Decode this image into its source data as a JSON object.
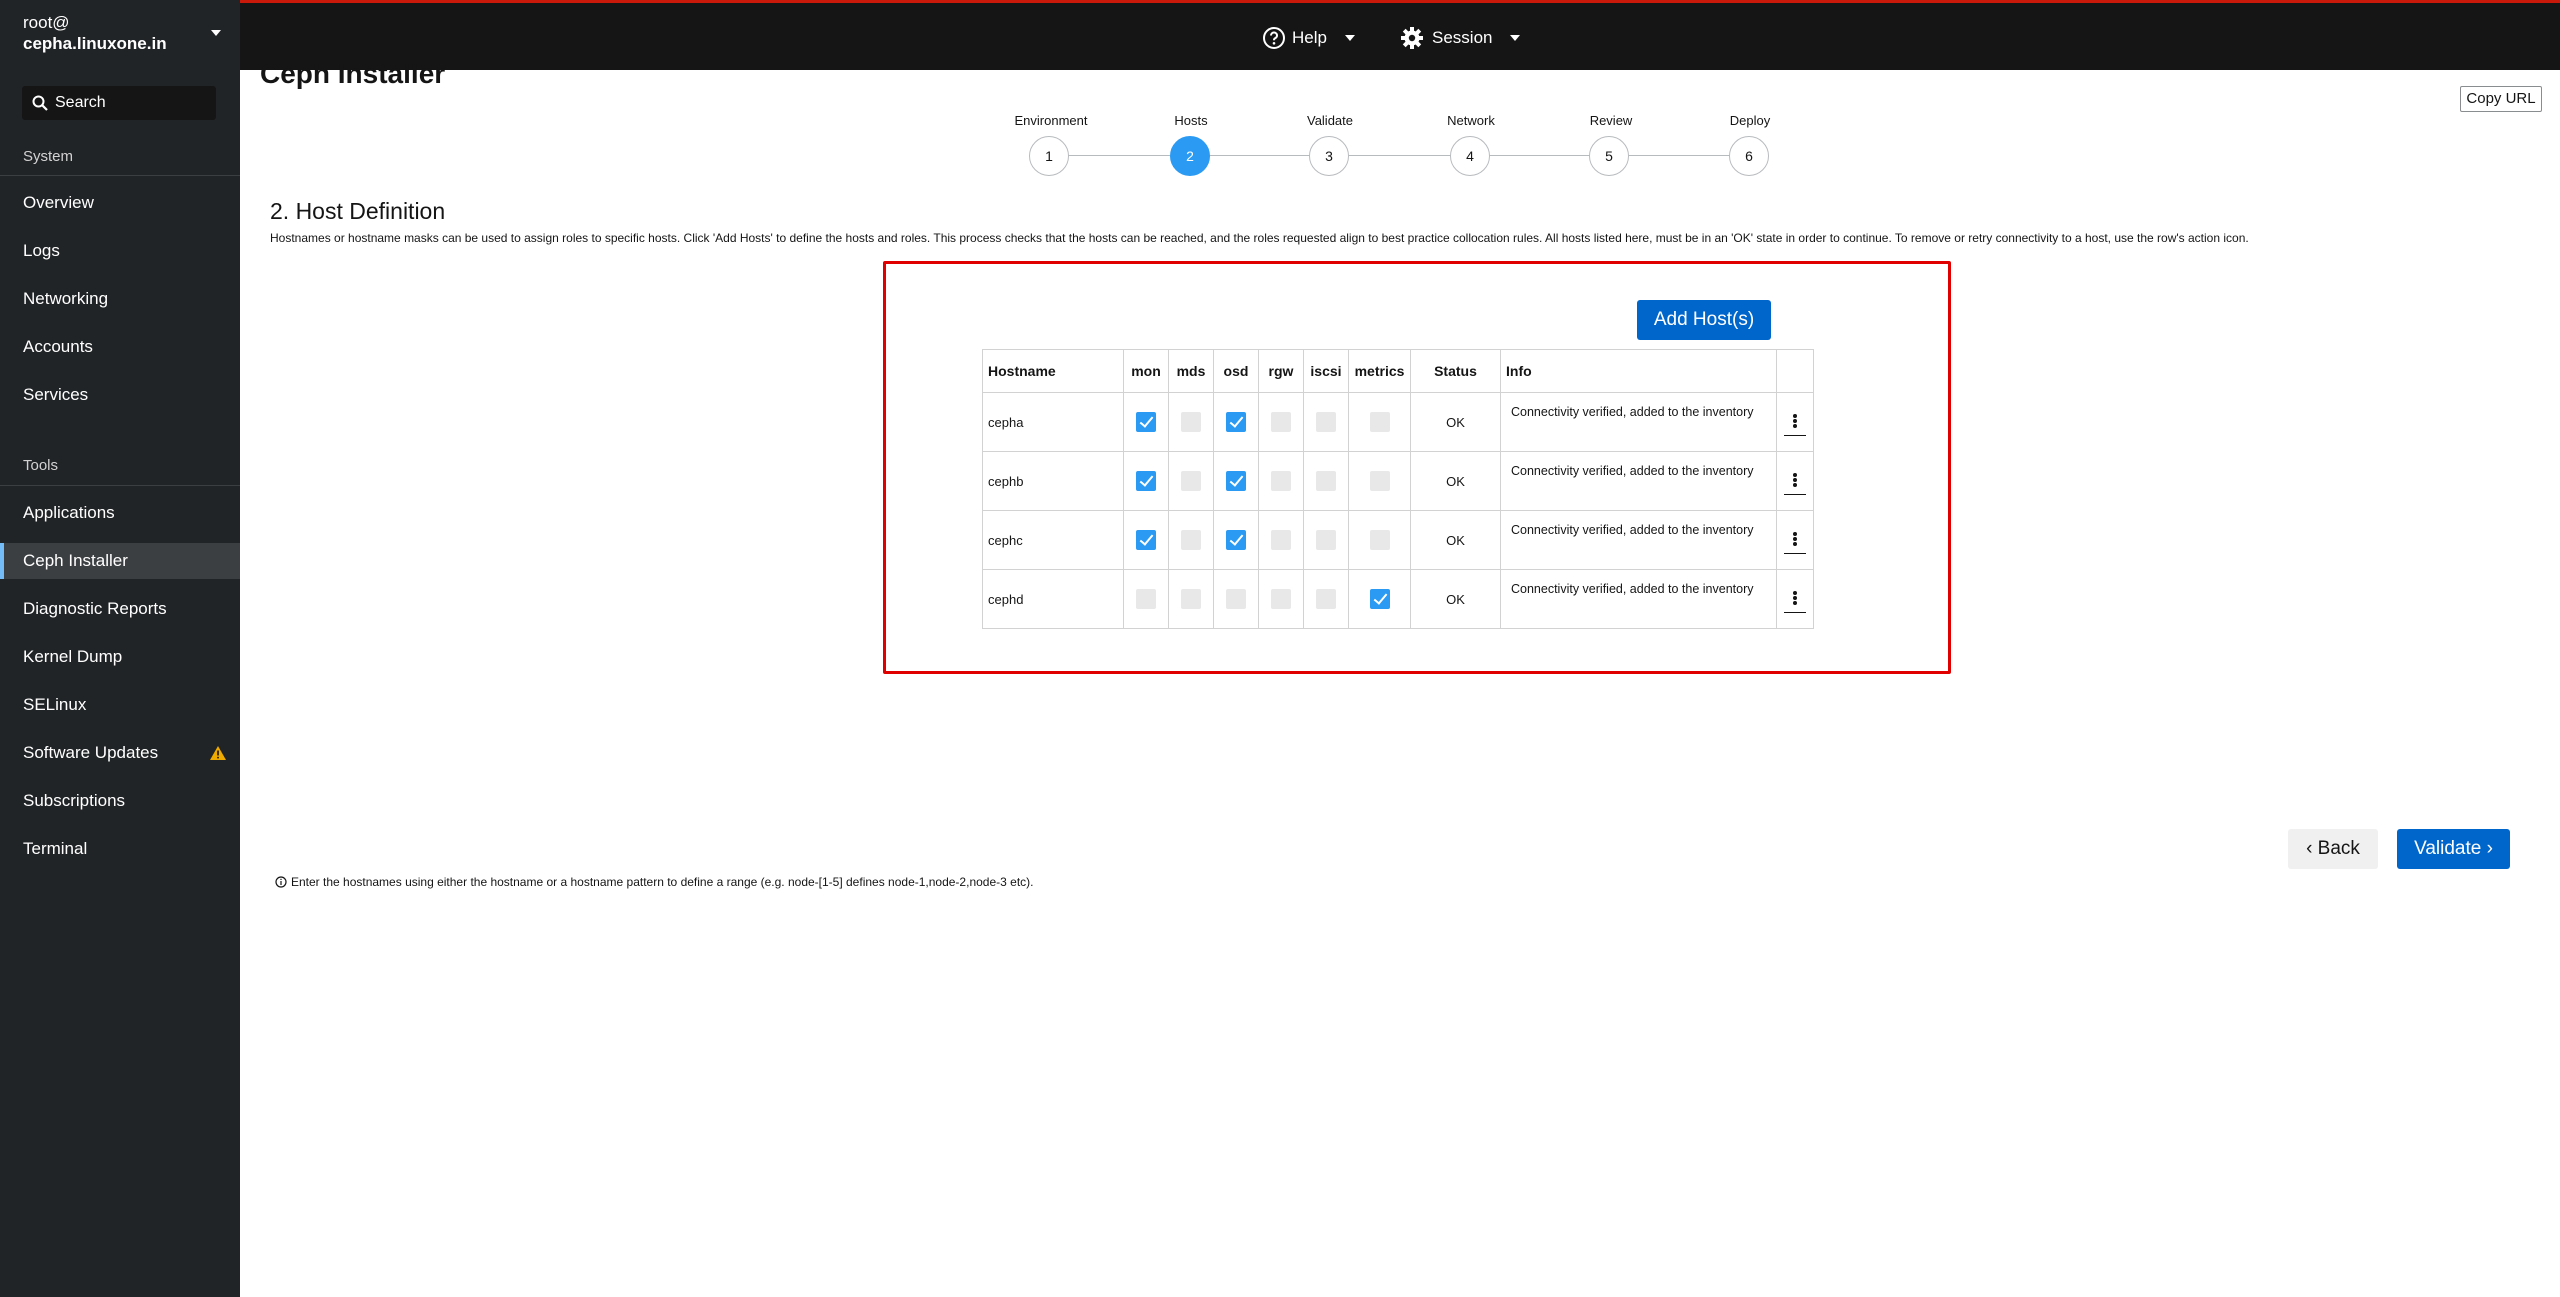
{
  "sidebar": {
    "user_line1": "root@",
    "user_line2": "cepha.linuxone.in",
    "search_placeholder": "Search",
    "section_system": "System",
    "system_items": [
      {
        "label": "Overview"
      },
      {
        "label": "Logs"
      },
      {
        "label": "Networking"
      },
      {
        "label": "Accounts"
      },
      {
        "label": "Services"
      }
    ],
    "section_tools": "Tools",
    "tools_items": [
      {
        "label": "Applications"
      },
      {
        "label": "Ceph Installer"
      },
      {
        "label": "Diagnostic Reports"
      },
      {
        "label": "Kernel Dump"
      },
      {
        "label": "SELinux"
      },
      {
        "label": "Software Updates"
      },
      {
        "label": "Subscriptions"
      },
      {
        "label": "Terminal"
      }
    ],
    "active_item": "Ceph Installer"
  },
  "topbar": {
    "help_label": "Help",
    "session_label": "Session",
    "accent_color": "#c9190b"
  },
  "main": {
    "page_title": "Ceph Installer",
    "copy_url_label": "Copy URL",
    "steps": [
      {
        "label": "Environment",
        "number": "1"
      },
      {
        "label": "Hosts",
        "number": "2"
      },
      {
        "label": "Validate",
        "number": "3"
      },
      {
        "label": "Network",
        "number": "4"
      },
      {
        "label": "Review",
        "number": "5"
      },
      {
        "label": "Deploy",
        "number": "6"
      }
    ],
    "active_step": 2,
    "section_title": "2. Host Definition",
    "section_desc": "Hostnames or hostname masks can be used to assign roles to specific hosts. Click 'Add Hosts' to define the hosts and roles. This process checks that the hosts can be reached, and the roles requested align to best practice collocation rules. All hosts listed here, must be in an 'OK' state in order to continue. To remove or retry connectivity to a host, use the row's action icon.",
    "add_host_label": "Add Host(s)",
    "table": {
      "headers": [
        "Hostname",
        "mon",
        "mds",
        "osd",
        "rgw",
        "iscsi",
        "metrics",
        "Status",
        "Info"
      ],
      "rows": [
        {
          "hostname": "cepha",
          "mon": true,
          "mds": false,
          "osd": true,
          "rgw": false,
          "iscsi": false,
          "metrics": false,
          "status": "OK",
          "info": "Connectivity verified, added to the inventory"
        },
        {
          "hostname": "cephb",
          "mon": true,
          "mds": false,
          "osd": true,
          "rgw": false,
          "iscsi": false,
          "metrics": false,
          "status": "OK",
          "info": "Connectivity verified, added to the inventory"
        },
        {
          "hostname": "cephc",
          "mon": true,
          "mds": false,
          "osd": true,
          "rgw": false,
          "iscsi": false,
          "metrics": false,
          "status": "OK",
          "info": "Connectivity verified, added to the inventory"
        },
        {
          "hostname": "cephd",
          "mon": false,
          "mds": false,
          "osd": false,
          "rgw": false,
          "iscsi": false,
          "metrics": true,
          "status": "OK",
          "info": "Connectivity verified, added to the inventory"
        }
      ]
    },
    "back_label": "‹ Back",
    "validate_label": "Validate ›",
    "hint": "Enter the hostnames using either the hostname or a hostname pattern to define a range (e.g. node-[1-5] defines node-1,node-2,node-3 etc).",
    "primary_color": "#0066cc",
    "checked_color": "#2b9af3",
    "highlight_border_color": "#e00000"
  }
}
